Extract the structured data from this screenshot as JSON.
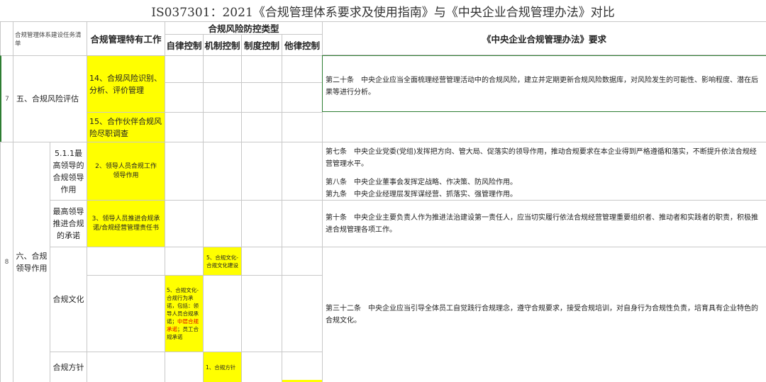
{
  "title": "IS037301：2021《合规管理体系要求及使用指南》与《中央企业合规管理办法》对比",
  "header": {
    "col_tasks": "合规管理体系建设任务清单",
    "col_special": "合规管理特有工作",
    "col_types_group": "合规风险防控类型",
    "types": [
      "自律控制",
      "机制控制",
      "制度控制",
      "他律控制"
    ],
    "col_law": "《中央企业合规管理办法》要求"
  },
  "rows": {
    "r7": {
      "num": "7",
      "task": "五、合规风险评估",
      "item1": "14、合规风险识别、分析、评价管理",
      "item2": "15、合作伙伴合规风险尽职调查",
      "law": "第二十条　中央企业应当全面梳理经营管理活动中的合规风险，建立并定期更新合规风险数据库，对风险发生的可能性、影响程度、潜在后果等进行分析。"
    },
    "r8": {
      "num": "8",
      "task": "六、合规领导作用",
      "sub1": "5.1.1最高领导的合规领导作用",
      "sub1_item": "2、领导人员合规工作领导作用",
      "sub1_law1": "第七条　中央企业党委(党组)发挥把方向、管大局、促落实的领导作用，推动合规要求在本企业得到严格遵循和落实，不断提升依法合规经营管理水平。",
      "sub1_law2": "第八条　中央企业董事会发挥定战略、作决策、防风险作用。",
      "sub1_law3": "第九条　中央企业经理层发挥谋经营、抓落实、强管理作用。",
      "sub2": "最高领导推进合规的承诺",
      "sub2_item": "3、领导人员推进合规承诺/合规经营管理责任书",
      "sub2_law": "第十条　中央企业主要负责人作为推进法治建设第一责任人，应当切实履行依法合规经营管理重要组织者、推动者和实践者的职责，积极推进合规管理各项工作。",
      "sub3": "合规文化",
      "sub3_mech": "5、合规文化-合规文化建设",
      "sub3_self_a": "5、合规文化-合规行为承诺，包括：领导人员合规承诺；",
      "sub3_self_red": "中层合规承诺",
      "sub3_self_b": "；员工合规承诺",
      "sub3_law": "第三十二条　中央企业应当引导全体员工自觉践行合规理念，遵守合规要求，接受合规培训，对自身行为合规性负责，培育具有企业特色的合规文化。",
      "sub4": "合规方针",
      "sub4_mech": "1、合规方针"
    }
  },
  "colors": {
    "highlight": "#ffff00",
    "border": "#c8c8c8",
    "accent_line": "#2e7d32",
    "warning_text": "#e00000"
  }
}
